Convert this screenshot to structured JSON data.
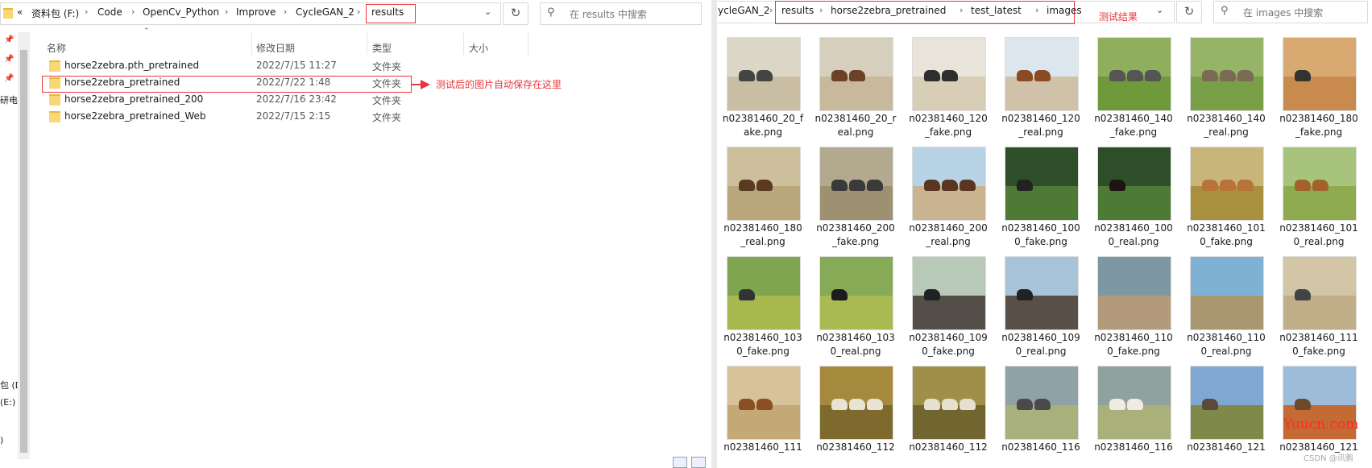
{
  "left": {
    "breadcrumbs": [
      "«",
      "资料包 (F:)",
      "Code",
      "OpenCv_Python",
      "Improve",
      "CycleGAN_2",
      "results"
    ],
    "search_placeholder": "在 results 中搜索",
    "columns": [
      "名称",
      "修改日期",
      "类型",
      "大小"
    ],
    "rows": [
      {
        "name": "horse2zebra.pth_pretrained",
        "date": "2022/7/15 11:27",
        "type": "文件夹"
      },
      {
        "name": "horse2zebra_pretrained",
        "date": "2022/7/22 1:48",
        "type": "文件夹"
      },
      {
        "name": "horse2zebra_pretrained_200",
        "date": "2022/7/16 23:42",
        "type": "文件夹"
      },
      {
        "name": "horse2zebra_pretrained_Web",
        "date": "2022/7/15 2:15",
        "type": "文件夹"
      }
    ],
    "annotation": "测试后的图片自动保存在这里",
    "nav_labels": [
      "研电",
      "包 (D",
      "(E:)",
      ")"
    ]
  },
  "right": {
    "breadcrumbs": [
      "ycleGAN_2",
      "results",
      "horse2zebra_pretrained",
      "test_latest",
      "images"
    ],
    "annotation": "测试结果",
    "search_placeholder": "在 images 中搜索",
    "files": [
      [
        "n02381460_20_f",
        "ake.png"
      ],
      [
        "n02381460_20_r",
        "eal.png"
      ],
      [
        "n02381460_120",
        "_fake.png"
      ],
      [
        "n02381460_120",
        "_real.png"
      ],
      [
        "n02381460_140",
        "_fake.png"
      ],
      [
        "n02381460_140",
        "_real.png"
      ],
      [
        "n02381460_180",
        "_fake.png"
      ],
      [
        "n02381460_180",
        "_real.png"
      ],
      [
        "n02381460_200",
        "_fake.png"
      ],
      [
        "n02381460_200",
        "_real.png"
      ],
      [
        "n02381460_100",
        "0_fake.png"
      ],
      [
        "n02381460_100",
        "0_real.png"
      ],
      [
        "n02381460_101",
        "0_fake.png"
      ],
      [
        "n02381460_101",
        "0_real.png"
      ],
      [
        "n02381460_103",
        "0_fake.png"
      ],
      [
        "n02381460_103",
        "0_real.png"
      ],
      [
        "n02381460_109",
        "0_fake.png"
      ],
      [
        "n02381460_109",
        "0_real.png"
      ],
      [
        "n02381460_110",
        "0_fake.png"
      ],
      [
        "n02381460_110",
        "0_real.png"
      ],
      [
        "n02381460_111",
        "0_fake.png"
      ],
      [
        "n02381460_111",
        ""
      ],
      [
        "n02381460_112",
        ""
      ],
      [
        "n02381460_112",
        ""
      ],
      [
        "n02381460_116",
        ""
      ],
      [
        "n02381460_116",
        ""
      ],
      [
        "n02381460_121",
        ""
      ],
      [
        "n02381460_121",
        ""
      ]
    ],
    "thumbs": [
      {
        "sky": "#dcd6c7",
        "ground": "#c9bea4",
        "ani": "#444",
        "n": 2
      },
      {
        "sky": "#d6cfbd",
        "ground": "#c8b99c",
        "ani": "#6b4226",
        "n": 2
      },
      {
        "sky": "#e9e4da",
        "ground": "#d8cdb6",
        "ani": "#2e2e2e",
        "n": 2
      },
      {
        "sky": "#dbe6ee",
        "ground": "#cfc2a8",
        "ani": "#8a4a22",
        "n": 2
      },
      {
        "sky": "#8fae5e",
        "ground": "#6e9a3c",
        "ani": "#555",
        "n": 3
      },
      {
        "sky": "#97b366",
        "ground": "#79a047",
        "ani": "#7b6a55",
        "n": 3
      },
      {
        "sky": "#d9a972",
        "ground": "#c98a4d",
        "ani": "#333",
        "n": 1
      },
      {
        "sky": "#cdbf9b",
        "ground": "#b9a67a",
        "ani": "#5a3a22",
        "n": 2
      },
      {
        "sky": "#b3a98f",
        "ground": "#9d9171",
        "ani": "#3a3a3a",
        "n": 3
      },
      {
        "sky": "#b8d3e6",
        "ground": "#c9b391",
        "ani": "#5a3520",
        "n": 3
      },
      {
        "sky": "#2f4f2a",
        "ground": "#4e7a35",
        "ani": "#222",
        "n": 1
      },
      {
        "sky": "#2e4e2a",
        "ground": "#4d7a35",
        "ani": "#1e1410",
        "n": 1
      },
      {
        "sky": "#c8b57a",
        "ground": "#a9903f",
        "ani": "#b7733a",
        "n": 3
      },
      {
        "sky": "#a8c37c",
        "ground": "#8eab4f",
        "ani": "#a3622c",
        "n": 2
      },
      {
        "sky": "#7fa550",
        "ground": "#a7b84e",
        "ani": "#333",
        "n": 1
      },
      {
        "sky": "#86aa56",
        "ground": "#a9ba52",
        "ani": "#1c1c1c",
        "n": 1
      },
      {
        "sky": "#b8c9b8",
        "ground": "#534f48",
        "ani": "#222",
        "n": 1
      },
      {
        "sky": "#a7c3d8",
        "ground": "#585048",
        "ani": "#222",
        "n": 1
      },
      {
        "sky": "#7e98a3",
        "ground": "#b29a7a",
        "ani": "#8a7358",
        "n": 0
      },
      {
        "sky": "#7fb2d2",
        "ground": "#a9976f",
        "ani": "#8a7358",
        "n": 0
      },
      {
        "sky": "#d2c6a6",
        "ground": "#bfae87",
        "ani": "#444",
        "n": 1
      },
      {
        "sky": "#d8c29a",
        "ground": "#c4a876",
        "ani": "#8a4f22",
        "n": 2
      },
      {
        "sky": "#a58a3e",
        "ground": "#7d6a2c",
        "ani": "#e9e3d3",
        "n": 3
      },
      {
        "sky": "#9f8f49",
        "ground": "#716530",
        "ani": "#e7e0d0",
        "n": 3
      },
      {
        "sky": "#8fa2a8",
        "ground": "#a8b07c",
        "ani": "#4a4a4a",
        "n": 2
      },
      {
        "sky": "#8fa2a0",
        "ground": "#a9b07a",
        "ani": "#efeae2",
        "n": 2
      },
      {
        "sky": "#7fa7d2",
        "ground": "#7f8a4a",
        "ani": "#5b4a3a",
        "n": 1
      },
      {
        "sky": "#9dbcd9",
        "ground": "#c36b32",
        "ani": "#6b4a2a",
        "n": 1
      }
    ],
    "watermark": "Yuucn.com",
    "csdn": "CSDN @讯鹏"
  }
}
